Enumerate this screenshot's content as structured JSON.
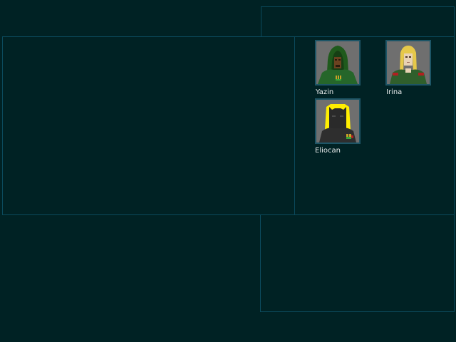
{
  "roster": {
    "characters": [
      {
        "name": "Yazin",
        "portrait_icon": "hooded-figure-portrait-icon"
      },
      {
        "name": "Irina",
        "portrait_icon": "blonde-officer-portrait-icon"
      },
      {
        "name": "Eliocan",
        "portrait_icon": "dark-horned-figure-portrait-icon"
      }
    ]
  },
  "colors": {
    "background": "#002224",
    "panel_border": "#0b4a5c",
    "portrait_frame": "#1d5566",
    "portrait_bg": "#6f6f6f",
    "label_text": "#e8ecec"
  }
}
